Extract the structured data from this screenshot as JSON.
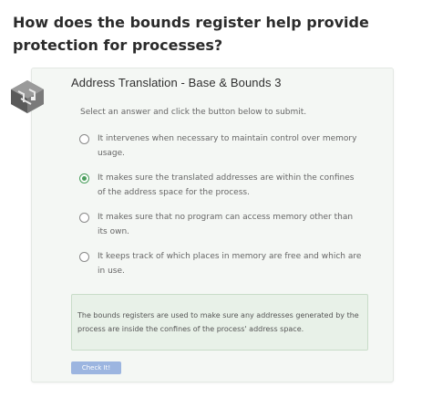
{
  "question": {
    "title": "How does the bounds register help provide protection for processes?"
  },
  "card": {
    "title": "Address Translation - Base & Bounds 3",
    "instruction": "Select an answer and click the button below to submit.",
    "options": [
      {
        "label": "It intervenes when necessary to maintain control over memory usage.",
        "selected": false
      },
      {
        "label": "It makes sure the translated addresses are within the confines of the address space for the process.",
        "selected": true
      },
      {
        "label": "It makes sure that no program can access memory other than its own.",
        "selected": false
      },
      {
        "label": "It keeps track of which places in memory are free and which are in use.",
        "selected": false
      }
    ],
    "feedback": "The bounds registers are used to make sure any addresses generated by the process are inside the confines of the process' address space.",
    "submit_label": "Check It!"
  },
  "colors": {
    "accent_green": "#4a9e5c",
    "button_blue": "#9cb5e0",
    "feedback_bg": "#e8f1e8"
  },
  "icons": {
    "badge": "maze-badge-icon"
  }
}
